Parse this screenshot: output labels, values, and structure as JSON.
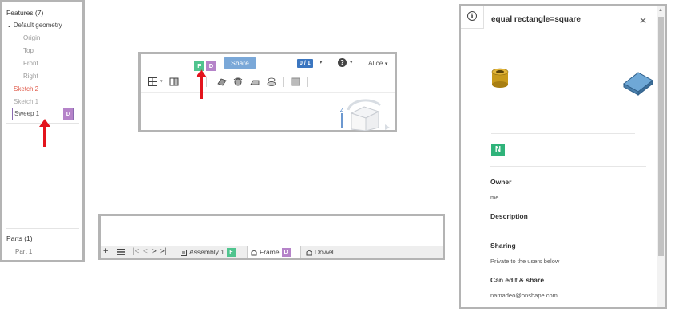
{
  "features_panel": {
    "header": "Features (7)",
    "default_geometry": "Default geometry",
    "planes": [
      "Origin",
      "Top",
      "Front",
      "Right"
    ],
    "sketch_2": "Sketch 2",
    "sketch_1": "Sketch 1",
    "rename_input_value": "Sweep 1",
    "rename_badge": "D",
    "parts_header": "Parts (1)",
    "part_item": "Part 1"
  },
  "toolbar_panel": {
    "badge_f": "F",
    "badge_d": "D",
    "share_label": "Share",
    "counter": "0 / 1",
    "user_name": "Alice"
  },
  "tabbar_panel": {
    "tabs": [
      {
        "label": "Assembly 1",
        "badge": "F"
      },
      {
        "label": "Frame",
        "badge": "D"
      },
      {
        "label": "Dowel"
      }
    ]
  },
  "info_panel": {
    "title": "equal rectangle=square",
    "n_badge": "N",
    "owner_label": "Owner",
    "owner_value": "me",
    "description_label": "Description",
    "sharing_label": "Sharing",
    "sharing_value": "Private to the users below",
    "can_edit_label": "Can edit & share",
    "can_edit_value": "namadeo@onshape.com"
  },
  "colors": {
    "arrow_red": "#e3141d",
    "badge_f_green": "#4fc48e",
    "badge_d_purple": "#b583c9",
    "share_blue": "#7aa8d8",
    "counter_blue": "#3b76c0",
    "sketch_red": "#e05a4a",
    "n_badge_green": "#2fb37a"
  },
  "icons": [
    "chevron-down-icon",
    "info-icon",
    "close-icon",
    "help-icon",
    "view-cube-icon",
    "cylinder-thumbnail-icon",
    "plate-thumbnail-icon"
  ]
}
